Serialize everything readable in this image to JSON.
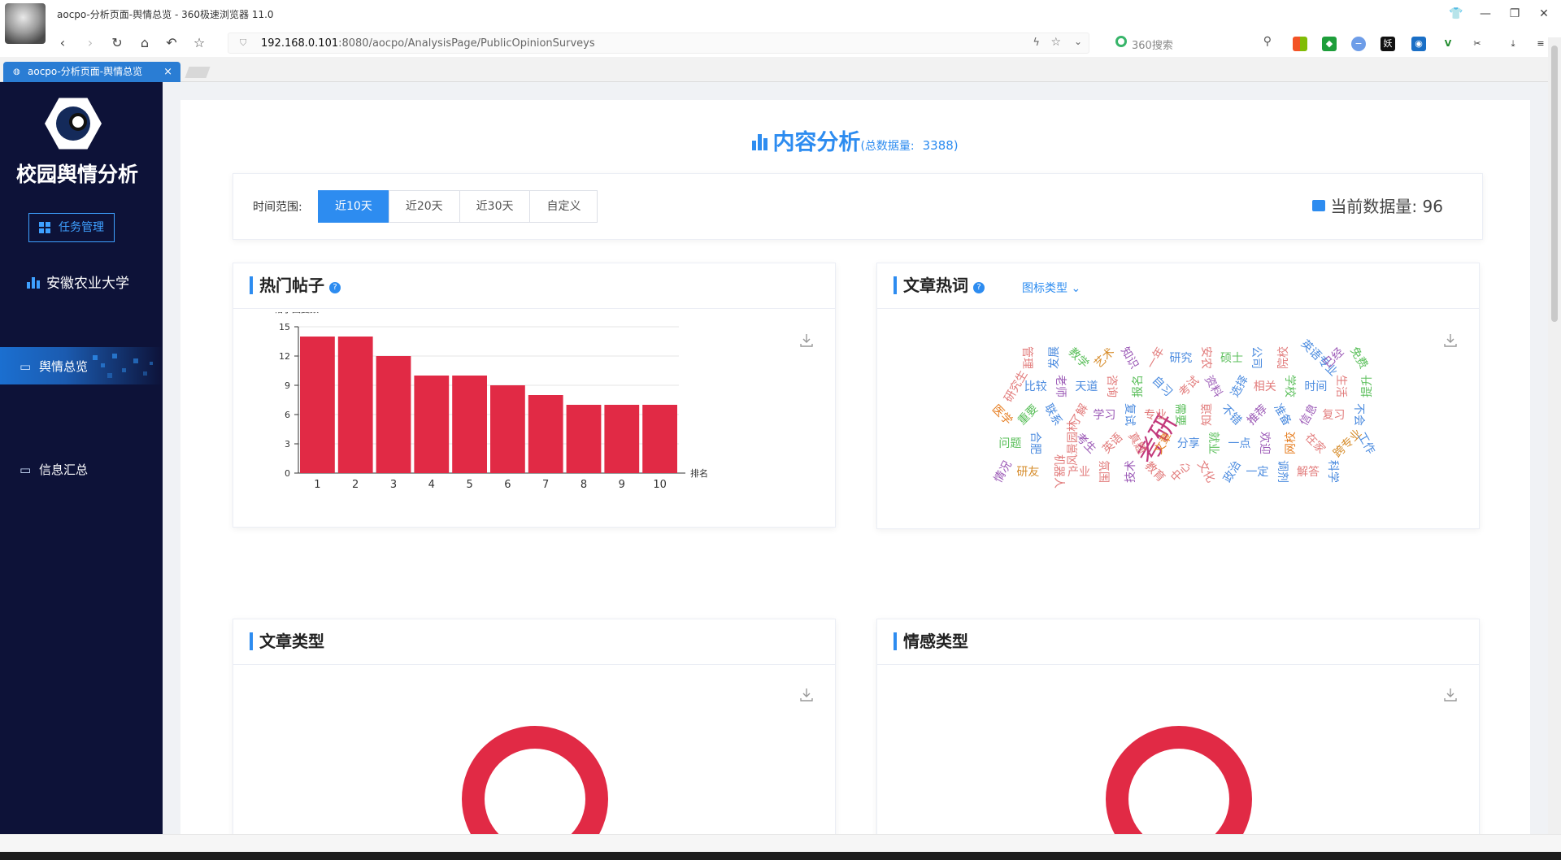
{
  "browser": {
    "window_title": "aocpo-分析页面-舆情总览 - 360极速浏览器 11.0",
    "url_host": "192.168.0.101",
    "url_rest": ":8080/aocpo/AnalysisPage/PublicOpinionSurveys",
    "search_placeholder": "360搜索",
    "tab_title": "aocpo-分析页面-舆情总览",
    "tab_close": "×"
  },
  "sidebar": {
    "brand": "校园舆情分析",
    "task_button": "任务管理",
    "university": "安徽农业大学",
    "menu": [
      {
        "label": "舆情总览",
        "active": true
      },
      {
        "label": "信息汇总",
        "active": false
      }
    ]
  },
  "header": {
    "title": "内容分析",
    "total_label": "(总数据量:",
    "total_value": "3388)"
  },
  "filter": {
    "label": "时间范围:",
    "options": [
      "近10天",
      "近20天",
      "近30天",
      "自定义"
    ],
    "selected": "近10天",
    "current_label": "当前数据量:",
    "current_value": "96"
  },
  "cards": {
    "hot_posts": {
      "title": "热门帖子",
      "help": "?"
    },
    "hot_words": {
      "title": "文章热词",
      "help": "?",
      "chart_type_label": "图标类型"
    },
    "article_type": {
      "title": "文章类型"
    },
    "sentiment": {
      "title": "情感类型"
    }
  },
  "chart_data": {
    "type": "bar",
    "ylabel": "帖子回复数",
    "xlabel": "排名",
    "categories": [
      "1",
      "2",
      "3",
      "4",
      "5",
      "6",
      "7",
      "8",
      "9",
      "10"
    ],
    "values": [
      14,
      14,
      12,
      10,
      10,
      9,
      8,
      7,
      7,
      7
    ],
    "ylim": [
      0,
      15
    ],
    "yticks": [
      0,
      3,
      6,
      9,
      12,
      15
    ],
    "color": "#e12a45"
  },
  "word_cloud": {
    "words": [
      {
        "t": "考研",
        "c": "#c2387b"
      },
      {
        "t": "管理",
        "c": "#e27c7c"
      },
      {
        "t": "发展",
        "c": "#4b8bdf"
      },
      {
        "t": "教学",
        "c": "#5bbf5b"
      },
      {
        "t": "艺术",
        "c": "#d68c2b"
      },
      {
        "t": "知识",
        "c": "#9b59b6"
      },
      {
        "t": "一年",
        "c": "#e27c7c"
      },
      {
        "t": "研究",
        "c": "#4b8bdf"
      },
      {
        "t": "安农",
        "c": "#e27c7c"
      },
      {
        "t": "硕士",
        "c": "#5bbf5b"
      },
      {
        "t": "公司",
        "c": "#4b8bdf"
      },
      {
        "t": "院校",
        "c": "#e27c7c"
      },
      {
        "t": "英语专业",
        "c": "#4b8bdf"
      },
      {
        "t": "已经",
        "c": "#9b59b6"
      },
      {
        "t": "免费",
        "c": "#5bbf5b"
      },
      {
        "t": "研究生",
        "c": "#e27c7c"
      },
      {
        "t": "比较",
        "c": "#4b8bdf"
      },
      {
        "t": "老师",
        "c": "#9b59b6"
      },
      {
        "t": "天道",
        "c": "#4b8bdf"
      },
      {
        "t": "咨询",
        "c": "#e27c7c"
      },
      {
        "t": "报名",
        "c": "#5bbf5b"
      },
      {
        "t": "自习",
        "c": "#4b8bdf"
      },
      {
        "t": "考试",
        "c": "#e27c7c"
      },
      {
        "t": "资料",
        "c": "#9b59b6"
      },
      {
        "t": "选择",
        "c": "#4b8bdf"
      },
      {
        "t": "相关",
        "c": "#e27c7c"
      },
      {
        "t": "学校",
        "c": "#5bbf5b"
      },
      {
        "t": "时间",
        "c": "#4b8bdf"
      },
      {
        "t": "生活",
        "c": "#e27c7c"
      },
      {
        "t": "提升",
        "c": "#5bbf5b"
      },
      {
        "t": "医学",
        "c": "#e67e22"
      },
      {
        "t": "重要",
        "c": "#5bbf5b"
      },
      {
        "t": "联系",
        "c": "#4b8bdf"
      },
      {
        "t": "了解",
        "c": "#e27c7c"
      },
      {
        "t": "学习",
        "c": "#9b59b6"
      },
      {
        "t": "复试",
        "c": "#4b8bdf"
      },
      {
        "t": "专业",
        "c": "#e27c7c"
      },
      {
        "t": "需要",
        "c": "#5bbf5b"
      },
      {
        "t": "知道",
        "c": "#e27c7c"
      },
      {
        "t": "不错",
        "c": "#4b8bdf"
      },
      {
        "t": "推荐",
        "c": "#9b59b6"
      },
      {
        "t": "准备",
        "c": "#4b8bdf"
      },
      {
        "t": "信息",
        "c": "#9b59b6"
      },
      {
        "t": "复习",
        "c": "#e27c7c"
      },
      {
        "t": "不会",
        "c": "#4b8bdf"
      },
      {
        "t": "问题",
        "c": "#5bbf5b"
      },
      {
        "t": "合肥",
        "c": "#4b8bdf"
      },
      {
        "t": "风景园林",
        "c": "#e27c7c"
      },
      {
        "t": "考生",
        "c": "#9b59b6"
      },
      {
        "t": "英语",
        "c": "#e27c7c"
      },
      {
        "t": "真题",
        "c": "#e27c7c"
      },
      {
        "t": "文章",
        "c": "#e67e22"
      },
      {
        "t": "分享",
        "c": "#4b8bdf"
      },
      {
        "t": "就业",
        "c": "#5bbf5b"
      },
      {
        "t": "一点",
        "c": "#4b8bdf"
      },
      {
        "t": "欢迎",
        "c": "#9b59b6"
      },
      {
        "t": "网校",
        "c": "#e67e22"
      },
      {
        "t": "在家",
        "c": "#e27c7c"
      },
      {
        "t": "跨专业",
        "c": "#d68c2b"
      },
      {
        "t": "工作",
        "c": "#4b8bdf"
      },
      {
        "t": "情况",
        "c": "#9b59b6"
      },
      {
        "t": "研友",
        "c": "#d68c2b"
      },
      {
        "t": "机器人",
        "c": "#e27c7c"
      },
      {
        "t": "产业",
        "c": "#e27c7c"
      },
      {
        "t": "氛围",
        "c": "#e27c7c"
      },
      {
        "t": "技术",
        "c": "#9b59b6"
      },
      {
        "t": "教育",
        "c": "#e27c7c"
      },
      {
        "t": "中心",
        "c": "#e27c7c"
      },
      {
        "t": "文化",
        "c": "#e27c7c"
      },
      {
        "t": "政治",
        "c": "#4b8bdf"
      },
      {
        "t": "一定",
        "c": "#4b8bdf"
      },
      {
        "t": "调剂",
        "c": "#4b8bdf"
      },
      {
        "t": "解答",
        "c": "#e27c7c"
      },
      {
        "t": "科学",
        "c": "#4b8bdf"
      }
    ]
  }
}
